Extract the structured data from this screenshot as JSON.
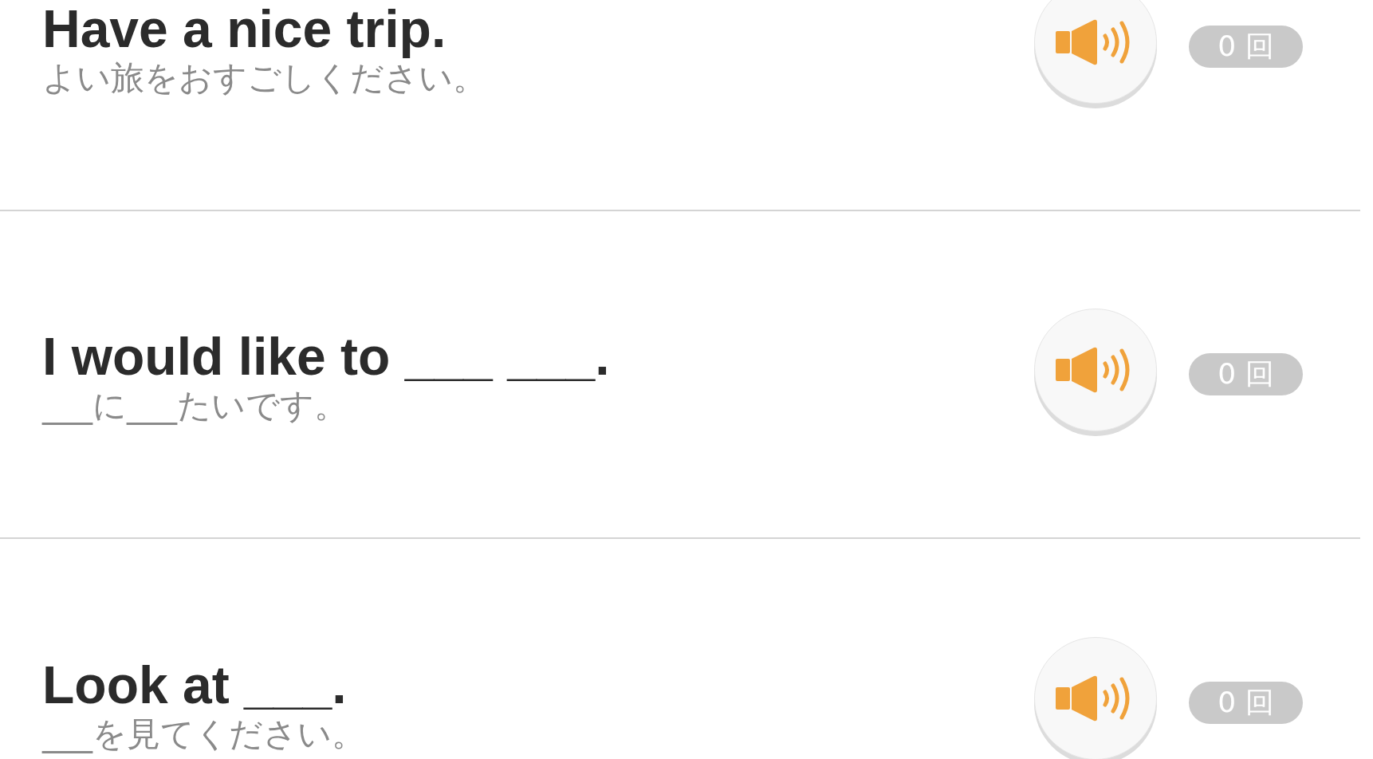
{
  "phrases": [
    {
      "english": "Have a nice trip.",
      "japanese": "よい旅をおすごしください。",
      "count": "0 回"
    },
    {
      "english": "I would like to ___ ___.",
      "japanese": "___に___たいです。",
      "count": "0 回"
    },
    {
      "english": "Look at ___.",
      "japanese": "___を見てください。",
      "count": "0 回"
    }
  ]
}
